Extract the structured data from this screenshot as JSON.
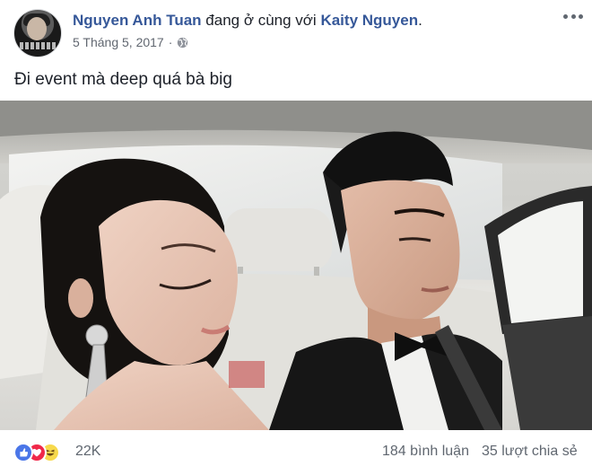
{
  "post": {
    "author_name": "Nguyen Anh Tuan",
    "with_text": "đang ở cùng với",
    "tagged_name": "Kaity Nguyen",
    "tagged_suffix": ".",
    "date": "5 Tháng 5, 2017",
    "meta_separator": "·",
    "privacy_icon": "globe-icon",
    "body_text": "Đi event mà deep quá bà big"
  },
  "reactions": {
    "icons": [
      "like-icon",
      "love-icon",
      "haha-icon"
    ],
    "count": "22K",
    "comments": "184 bình luận",
    "shares": "35 lượt chia sẻ"
  },
  "colors": {
    "link": "#365899",
    "meta": "#616770",
    "like": "#4a76e8",
    "love": "#f0284a",
    "haha": "#f7d94c"
  }
}
